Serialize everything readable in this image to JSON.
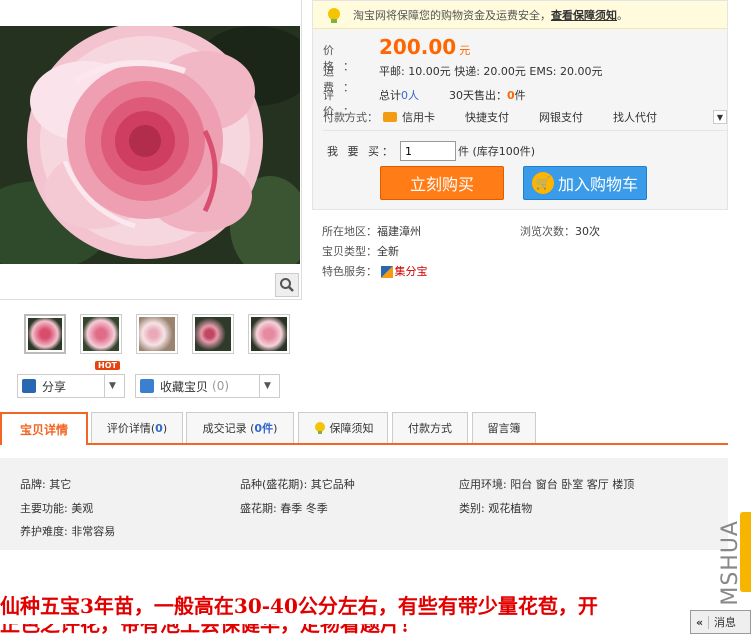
{
  "guarantee": {
    "text": "淘宝网将保障您的购物资金及运费安全，",
    "link": "查看保障须知",
    "tail": "。"
  },
  "price": {
    "label": "价　格：",
    "value": "200.00",
    "unit": "元"
  },
  "shipping": {
    "label": "运　费：",
    "text": "平邮: 10.00元 快递: 20.00元 EMS: 20.00元"
  },
  "rating": {
    "label": "评　价：",
    "total_prefix": "总计",
    "total": "0人",
    "sold_prefix": "30天售出：",
    "sold": "0",
    "sold_unit": "件"
  },
  "payment": {
    "label": "付款方式：",
    "options": [
      "信用卡",
      "快捷支付",
      "网银支付",
      "找人代付"
    ]
  },
  "buy": {
    "label": "我 要 买：",
    "quantity": "1",
    "stock": "件 (库存100件)",
    "buy_now": "立刻购买",
    "add_cart": "加入购物车"
  },
  "extra": {
    "location_label": "所在地区：",
    "location": "福建漳州",
    "views_label": "浏览次数：",
    "views": "30次",
    "type_label": "宝贝类型：",
    "type": "全新",
    "service_label": "特色服务：",
    "service": "集分宝"
  },
  "share": {
    "share_label": "分享",
    "hot": "HOT",
    "fav_label": "收藏宝贝",
    "fav_count": "(0)"
  },
  "tabs": [
    {
      "label": "宝贝详情"
    },
    {
      "label": "评价详情(",
      "num": "0",
      "tail": ")"
    },
    {
      "label": "成交记录 (",
      "num": "0件",
      "tail": ")"
    },
    {
      "label": "保障须知"
    },
    {
      "label": "付款方式"
    },
    {
      "label": "留言簿"
    }
  ],
  "attributes": {
    "brand": "品牌: 其它",
    "variety": "品种(盛花期): 其它品种",
    "env": "应用环境: 阳台 窗台 卧室 客厅 楼顶",
    "func": "主要功能: 美观",
    "season": "盛花期: 春季 冬季",
    "category": "类别: 观花植物",
    "care": "养护难度: 非常容易"
  },
  "description": {
    "line1": "仙种五宝3年苗，一般高在30-40公分左右，有些有带少量花苞，开",
    "line2": "正色之评花，带有泡土会保健华，定物看题片！"
  },
  "side": {
    "watermark": "MSHUA",
    "message_button": "消息",
    "arrow": "«"
  },
  "colors": {
    "accent": "#f26522",
    "price": "#ff6600",
    "buy": "#ff7c17",
    "cart": "#3a9be8",
    "link": "#3366cc",
    "desc_red": "#e10000"
  }
}
